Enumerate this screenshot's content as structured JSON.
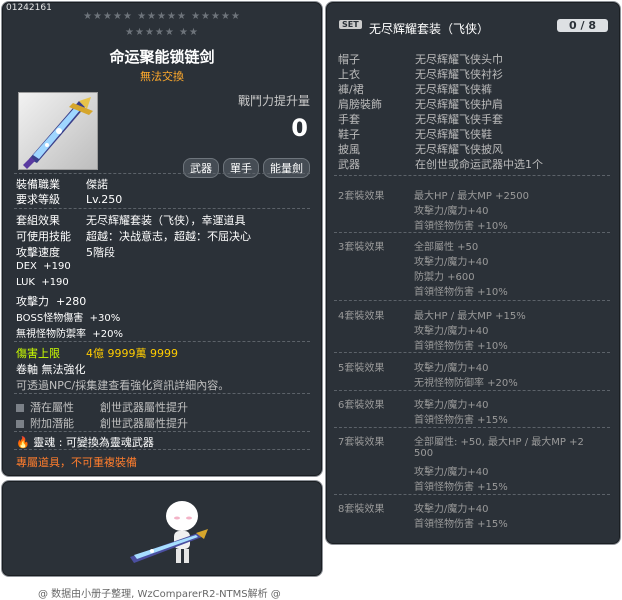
{
  "item": {
    "id": "01242161",
    "stars_row1": "★★★★★  ★★★★★  ★★★★★",
    "stars_row2": "★★★★★  ★★",
    "name": "命运聚能锁链剑",
    "trade": "無法交換",
    "combat_power_label": "戰鬥力提升量",
    "combat_power_value": "0",
    "tags": [
      "武器",
      "單手",
      "能量劍"
    ],
    "job_label": "裝備職業",
    "job_value": "傑諾",
    "req_label": "要求等級",
    "req_value": "Lv.250",
    "set_effect_label": "套組效果",
    "set_effect_value": "无尽辉耀套装（飞侠），幸運道具",
    "skill_label": "可使用技能",
    "skill_value": "超越：决战意志，超越：不屈决心",
    "speed_label": "攻擊速度",
    "speed_value": "5階段",
    "stats": [
      {
        "k": "DEX",
        "v": "+190"
      },
      {
        "k": "LUK",
        "v": "+190"
      },
      {
        "k": "攻擊力",
        "v": "+280"
      },
      {
        "k": "BOSS怪物傷害",
        "v": "+30%"
      },
      {
        "k": "無視怪物防禦率",
        "v": "+20%"
      }
    ],
    "dmg_cap_label": "傷害上限",
    "dmg_cap_value": "4億 9999萬 9999",
    "scroll_label": "卷軸",
    "scroll_value": "無法強化",
    "npc_note": "可透過NPC/採集建查看強化資訊詳細內容。",
    "potential_label": "潛在屬性",
    "potential_value": "創世武器屬性提升",
    "addl_label": "附加潛能",
    "addl_value": "創世武器屬性提升",
    "soul_label": "靈魂",
    "soul_value": "可變換為靈魂武器",
    "exclusive": "專屬道具，不可重複裝備"
  },
  "set": {
    "badge": "SET",
    "name": "无尽辉耀套装（飞侠）",
    "count": "0 / 8",
    "parts": [
      {
        "k": "帽子",
        "v": "无尽辉耀飞侠头巾"
      },
      {
        "k": "上衣",
        "v": "无尽辉耀飞侠衬衫"
      },
      {
        "k": "褲/裙",
        "v": "无尽辉耀飞侠裤"
      },
      {
        "k": "肩膀裝飾",
        "v": "无尽辉耀飞侠护肩"
      },
      {
        "k": "手套",
        "v": "无尽辉耀飞侠手套"
      },
      {
        "k": "鞋子",
        "v": "无尽辉耀飞侠鞋"
      },
      {
        "k": "披風",
        "v": "无尽辉耀飞侠披风"
      },
      {
        "k": "武器",
        "v": "在创世或命运武器中选1个"
      }
    ],
    "effects": [
      {
        "k": "2套裝效果",
        "lines": [
          "最大HP / 最大MP  +2500",
          "攻擊力/魔力+40",
          "首領怪物伤害 +10%"
        ]
      },
      {
        "k": "3套裝效果",
        "lines": [
          "全部屬性 +50",
          "攻擊力/魔力+40",
          "防禦力 +600",
          "首領怪物伤害 +10%"
        ]
      },
      {
        "k": "4套裝效果",
        "lines": [
          "最大HP / 最大MP  +15%",
          "攻擊力/魔力+40",
          "首領怪物伤害 +10%"
        ]
      },
      {
        "k": "5套裝效果",
        "lines": [
          "攻擊力/魔力+40",
          "无視怪物防御率 +20%"
        ]
      },
      {
        "k": "6套裝效果",
        "lines": [
          "攻擊力/魔力+40",
          "首領怪物伤害 +15%"
        ]
      },
      {
        "k": "7套裝效果",
        "lines": [
          "全部屬性: +50, 最大HP / 最大MP  +2",
          "500",
          "攻擊力/魔力+40",
          "首領怪物伤害 +15%"
        ]
      },
      {
        "k": "8套裝效果",
        "lines": [
          "攻擊力/魔力+40",
          "首領怪物伤害 +15%"
        ]
      }
    ]
  },
  "footer": "@ 数据由小册子整理, WzComparerR2-NTMS解析 @"
}
